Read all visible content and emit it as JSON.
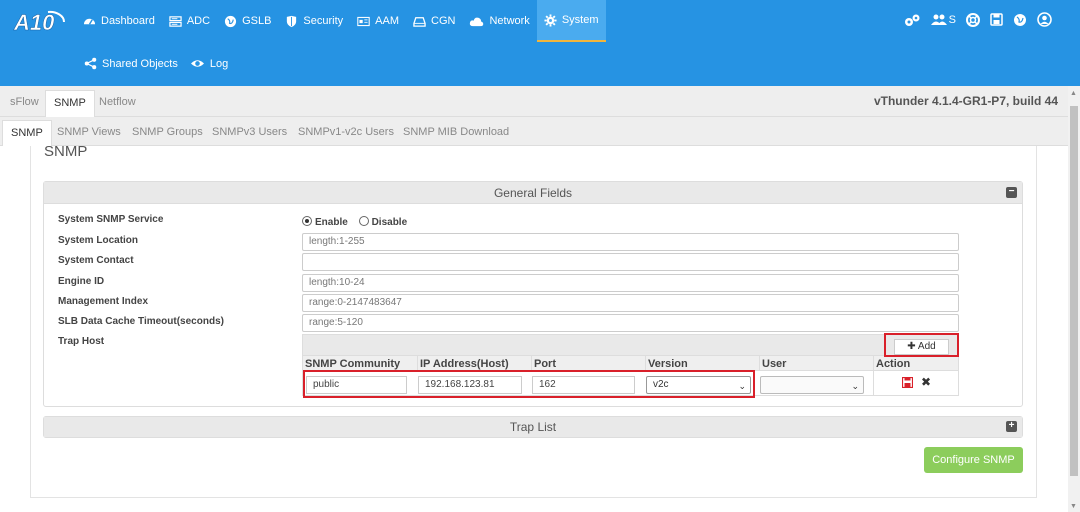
{
  "colors": {
    "topbar": "#2693e3",
    "active_accent": "#f0b53c",
    "highlight": "#d9202a",
    "configure_btn": "#8ccd5c"
  },
  "logo": {
    "text": "A10"
  },
  "nav": {
    "items": [
      {
        "label": "Dashboard",
        "icon": "dashboard-icon"
      },
      {
        "label": "ADC",
        "icon": "server-icon"
      },
      {
        "label": "GSLB",
        "icon": "globe-icon"
      },
      {
        "label": "Security",
        "icon": "shield-icon"
      },
      {
        "label": "AAM",
        "icon": "id-card-icon"
      },
      {
        "label": "CGN",
        "icon": "drive-icon"
      },
      {
        "label": "Network",
        "icon": "cloud-icon"
      },
      {
        "label": "System",
        "icon": "gear-icon"
      }
    ],
    "subnav": [
      {
        "label": "Shared Objects",
        "icon": "share-icon"
      },
      {
        "label": "Log",
        "icon": "eye-icon"
      }
    ],
    "right": {
      "user_badge": "S"
    }
  },
  "tabs1": {
    "items": [
      "sFlow",
      "SNMP",
      "Netflow"
    ],
    "build": "vThunder 4.1.4-GR1-P7, build 44"
  },
  "tabs2": {
    "items": [
      "SNMP",
      "SNMP Views",
      "SNMP Groups",
      "SNMPv3 Users",
      "SNMPv1-v2c Users",
      "SNMP MIB Download"
    ]
  },
  "page": {
    "title": "SNMP"
  },
  "general": {
    "header": "General Fields",
    "service_label": "System SNMP Service",
    "enable": "Enable",
    "disable": "Disable",
    "location_label": "System Location",
    "location_placeholder": "length:1-255",
    "contact_label": "System Contact",
    "contact_value": "",
    "engine_label": "Engine ID",
    "engine_placeholder": "length:10-24",
    "mgmt_label": "Management Index",
    "mgmt_placeholder": "range:0-2147483647",
    "slb_label": "SLB Data Cache Timeout(seconds)",
    "slb_placeholder": "range:5-120",
    "trap_label": "Trap Host"
  },
  "trap": {
    "add": "Add",
    "columns": [
      "SNMP Community",
      "IP Address(Host)",
      "Port",
      "Version",
      "User",
      "Action"
    ],
    "row": {
      "community": "public",
      "ip": "192.168.123.81",
      "port": "162",
      "version": "v2c",
      "user": ""
    }
  },
  "trap_list": {
    "header": "Trap List"
  },
  "configure": {
    "label": "Configure SNMP"
  }
}
